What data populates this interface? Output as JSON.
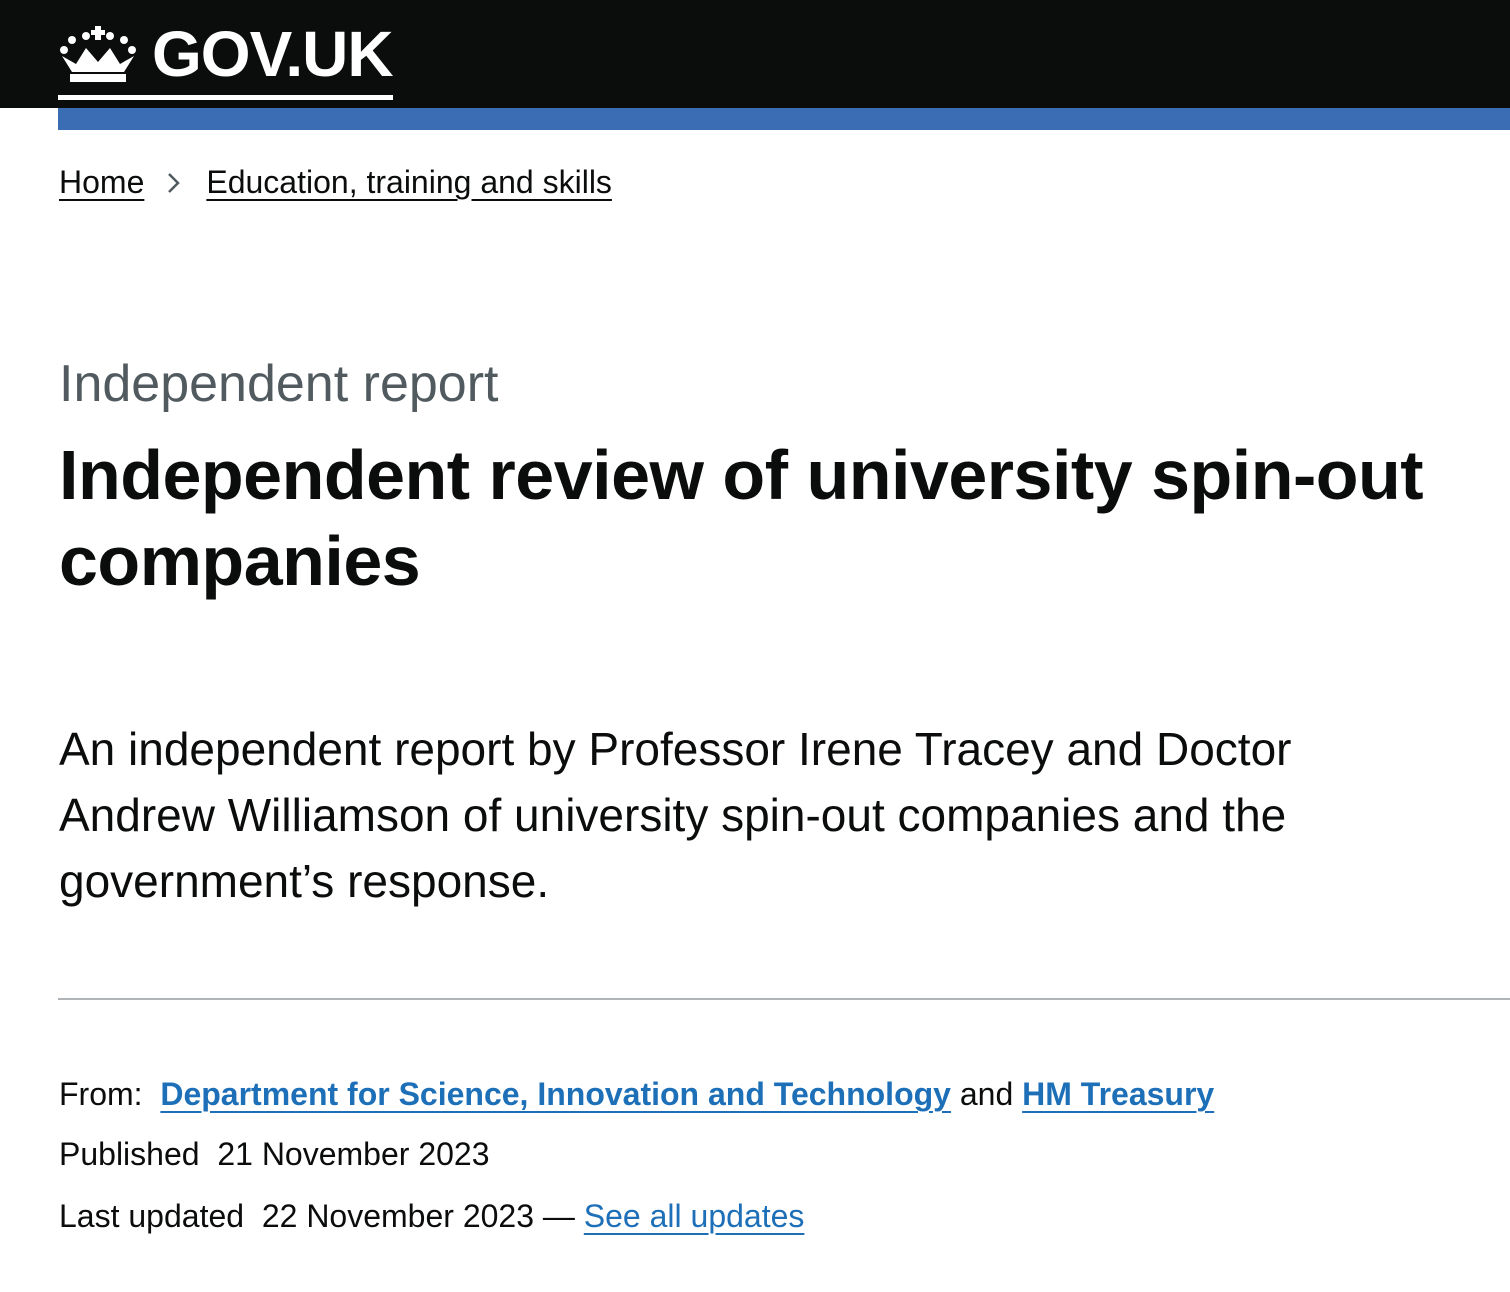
{
  "header": {
    "logo_text": "GOV.UK",
    "logo_icon": "crown-icon",
    "background": "#0b0c0c",
    "accent": "#3b6db4"
  },
  "breadcrumbs": [
    {
      "label": "Home"
    },
    {
      "label": "Education, training and skills"
    }
  ],
  "page": {
    "caption": "Independent report",
    "title": "Independent review of university spin-out companies",
    "lead": "An independent report by Professor Irene Tracey and Doctor Andrew Williamson of university spin-out companies and the government’s response."
  },
  "metadata": {
    "from_label": "From:",
    "organisations": [
      {
        "label": "Department for Science, Innovation and Technology"
      },
      {
        "label": "HM Treasury"
      }
    ],
    "conjunction": "and",
    "published_label": "Published",
    "published_date": "21 November 2023",
    "updated_label": "Last updated",
    "updated_date": "22 November 2023",
    "dash": "—",
    "see_all_updates": "See all updates",
    "link_color": "#1d70b8"
  }
}
